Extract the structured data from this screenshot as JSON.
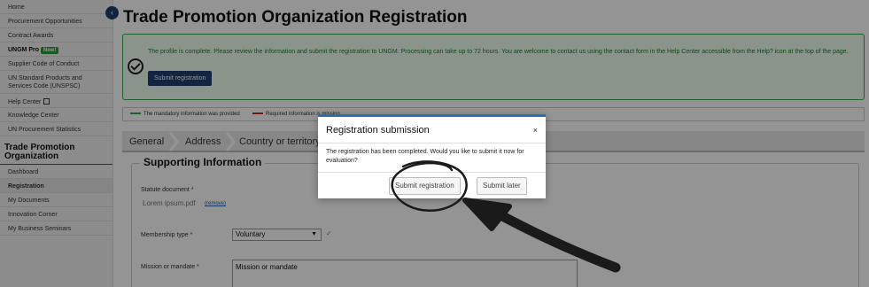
{
  "sidebar": {
    "items": [
      {
        "label": "Home"
      },
      {
        "label": "Procurement Opportunities"
      },
      {
        "label": "Contract Awards"
      },
      {
        "label": "UNGM Pro",
        "badge": "New!"
      },
      {
        "label": "Supplier Code of Conduct"
      },
      {
        "label": "UN Standard Products and Services Code (UNSPSC)"
      },
      {
        "label": "Help Center"
      },
      {
        "label": "Knowledge Center"
      },
      {
        "label": "UN Procurement Statistics"
      }
    ],
    "section_title": "Trade Promotion Organization",
    "section_items": [
      {
        "label": "Dashboard"
      },
      {
        "label": "Registration"
      },
      {
        "label": "My Documents"
      },
      {
        "label": "Innovation Corner"
      },
      {
        "label": "My Business Seminars"
      }
    ]
  },
  "page": {
    "title": "Trade Promotion Organization Registration"
  },
  "alert": {
    "text": "The profile is complete. Please review the information and submit the registration to UNGM. Processing can take up to 72 hours. You are welcome to contact us using the contact form in the Help Center accessible from the Help? icon at the top of the page.",
    "button_label": "Submit registration"
  },
  "legend": {
    "provided": "The mandatory information was provided",
    "missing": "Required information is missing"
  },
  "tabs": [
    "General",
    "Address",
    "Country or territory"
  ],
  "section": {
    "title": "Supporting Information",
    "statute_label": "Statute document *",
    "statute_file": "Lorem ipsum.pdf",
    "remove_label": "(remove)",
    "membership_label": "Membership type *",
    "membership_value": "Voluntary",
    "mission_label": "Mission or mandate *",
    "mission_value": "Mission or mandate"
  },
  "modal": {
    "title": "Registration submission",
    "close": "×",
    "body": "The registration has been completed. Would you like to submit it now for evaluation?",
    "submit_label": "Submit registration",
    "later_label": "Submit later"
  },
  "colors": {
    "primary": "#1f3f6d",
    "success": "#3aa44a",
    "error": "#cc2222",
    "modal_accent": "#2a6fb5"
  }
}
